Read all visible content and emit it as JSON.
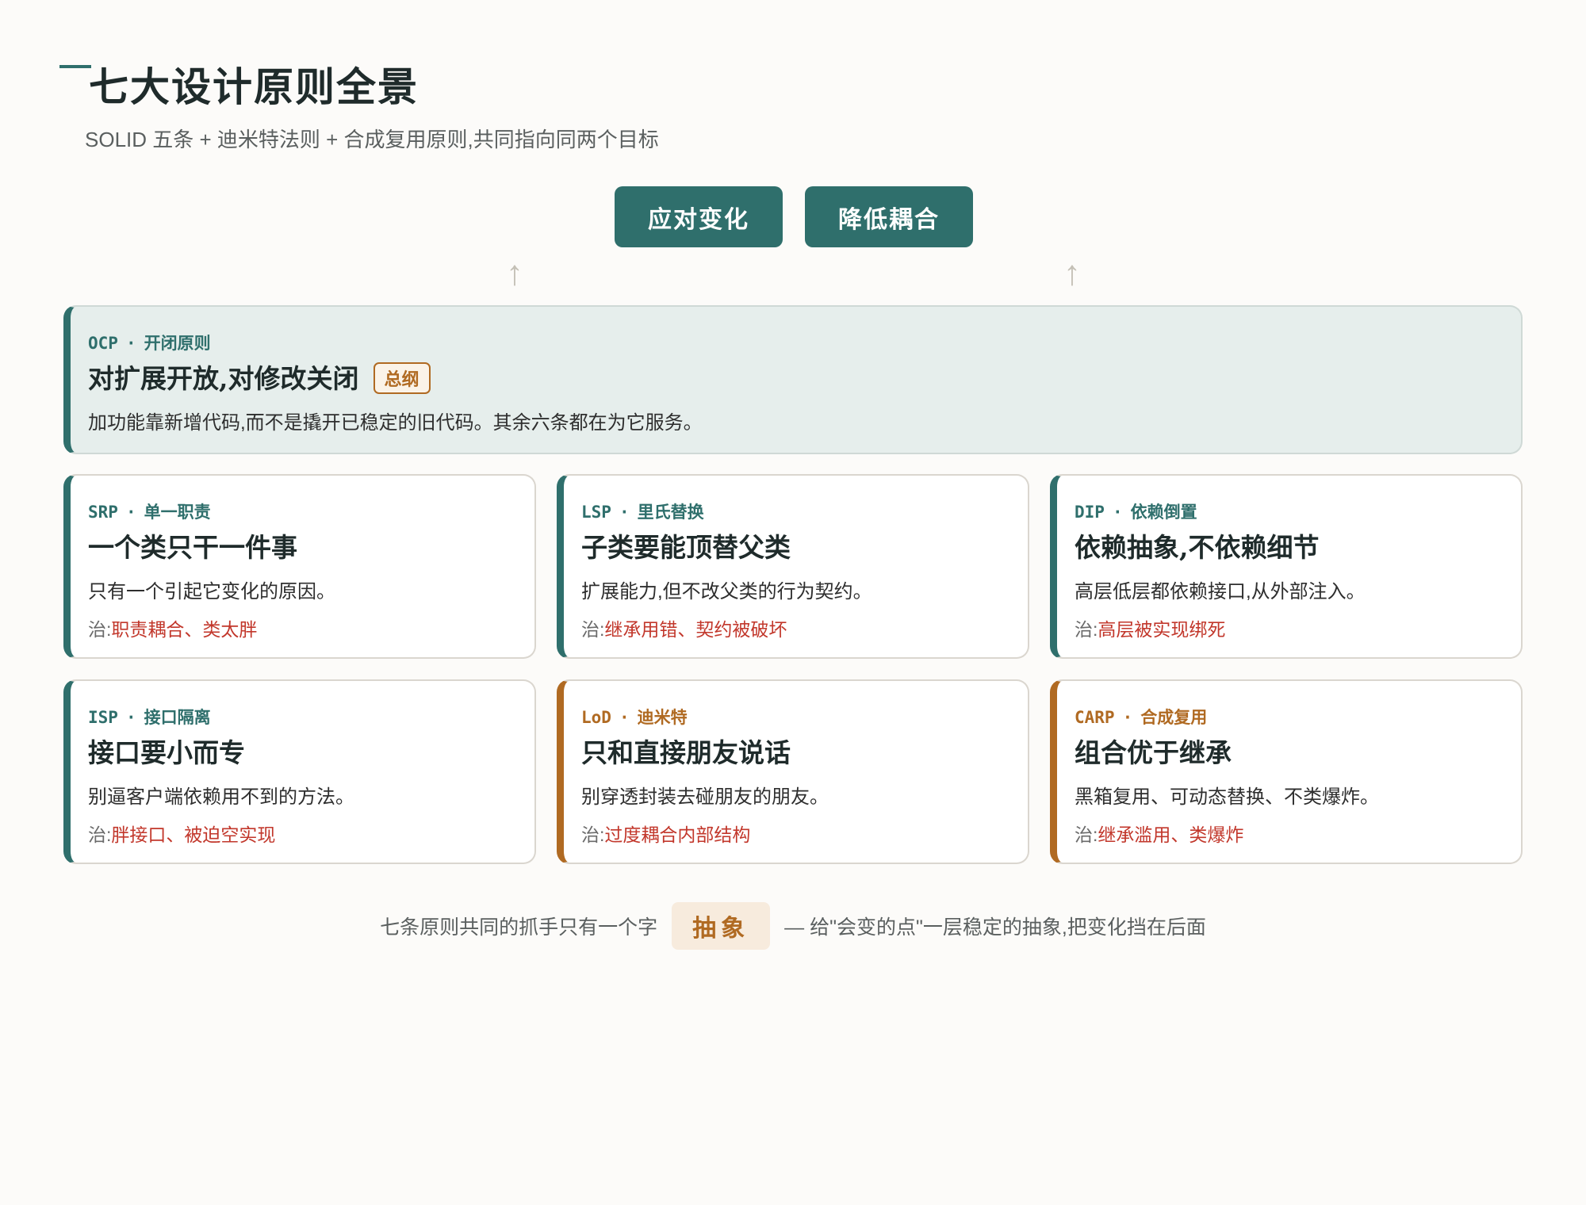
{
  "header": {
    "title": "七大设计原则全景",
    "subtitle": "SOLID 五条 + 迪米特法则 + 合成复用原则,共同指向同两个目标"
  },
  "goals": [
    "应对变化",
    "降低耦合"
  ],
  "ocp": {
    "code": "OCP",
    "name": "开闭原则",
    "headline": "对扩展开放,对修改关闭",
    "badge": "总纲",
    "desc": "加功能靠新增代码,而不是撬开已稳定的旧代码。其余六条都在为它服务。"
  },
  "principles": [
    {
      "code": "SRP",
      "name": "单一职责",
      "headline": "一个类只干一件事",
      "desc": "只有一个引起它变化的原因。",
      "treat_prefix": "治:",
      "treat": "职责耦合、类太胖"
    },
    {
      "code": "LSP",
      "name": "里氏替换",
      "headline": "子类要能顶替父类",
      "desc": "扩展能力,但不改父类的行为契约。",
      "treat_prefix": "治:",
      "treat": "继承用错、契约被破坏"
    },
    {
      "code": "DIP",
      "name": "依赖倒置",
      "headline": "依赖抽象,不依赖细节",
      "desc": "高层低层都依赖接口,从外部注入。",
      "treat_prefix": "治:",
      "treat": "高层被实现绑死"
    },
    {
      "code": "ISP",
      "name": "接口隔离",
      "headline": "接口要小而专",
      "desc": "别逼客户端依赖用不到的方法。",
      "treat_prefix": "治:",
      "treat": "胖接口、被迫空实现"
    },
    {
      "code": "LoD",
      "name": "迪米特",
      "headline": "只和直接朋友说话",
      "desc": "别穿透封装去碰朋友的朋友。",
      "treat_prefix": "治:",
      "treat": "过度耦合内部结构"
    },
    {
      "code": "CARP",
      "name": "合成复用",
      "headline": "组合优于继承",
      "desc": "黑箱复用、可动态替换、不类爆炸。",
      "treat_prefix": "治:",
      "treat": "继承滥用、类爆炸"
    }
  ],
  "footer": {
    "lead": "七条原则共同的抓手只有一个字",
    "keyword": "抽象",
    "tail": "— 给\"会变的点\"一层稳定的抽象,把变化挡在后面"
  },
  "colors": {
    "teal": "#2f6f6c",
    "amber": "#b06a22",
    "red": "#c2372b",
    "background": "#fcfbf9"
  },
  "icons": {
    "arrow": "up-arrow-icon"
  }
}
